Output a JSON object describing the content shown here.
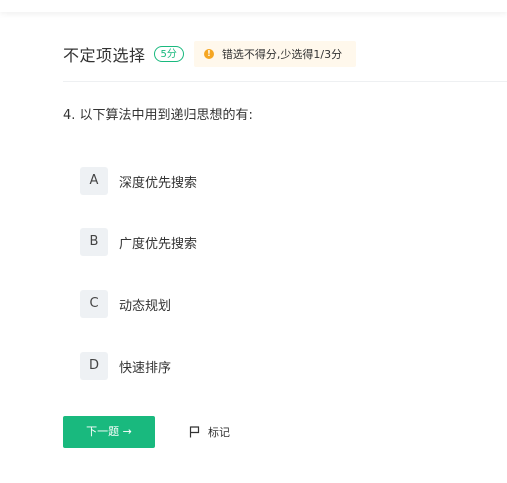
{
  "header": {
    "question_type": "不定项选择",
    "score_badge": "5分",
    "notice_text": "错选不得分,少选得1/3分",
    "notice_icon": "exclamation-icon",
    "notice_icon_glyph": "!"
  },
  "question": {
    "text": "4. 以下算法中用到递归思想的有:"
  },
  "options": [
    {
      "key": "A",
      "text": "深度优先搜索"
    },
    {
      "key": "B",
      "text": "广度优先搜索"
    },
    {
      "key": "C",
      "text": "动态规划"
    },
    {
      "key": "D",
      "text": "快速排序"
    }
  ],
  "actions": {
    "next_label": "下一题 →",
    "mark_label": "标记",
    "mark_icon": "flag-icon"
  },
  "colors": {
    "accent": "#19b97e",
    "notice_bg": "#fff8ec",
    "notice_icon": "#f5a623",
    "option_key_bg": "#eef1f4"
  }
}
